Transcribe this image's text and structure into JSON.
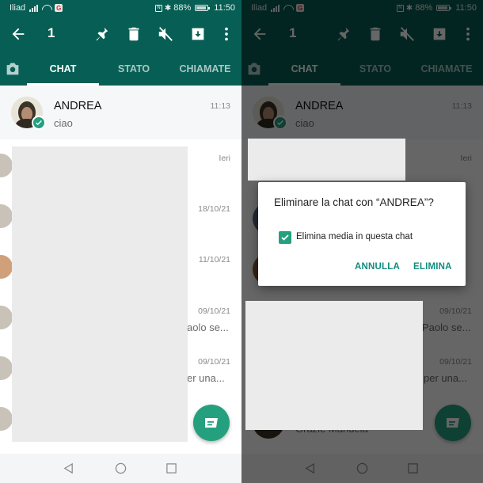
{
  "status_bar": {
    "carrier": "Iliad",
    "battery": "88%",
    "clock": "11:50",
    "icons": [
      "signal-icon",
      "wifi-icon",
      "app-notification-icon",
      "nfc-icon",
      "bluetooth-icon",
      "battery-icon"
    ]
  },
  "action_bar": {
    "selected_count": "1",
    "actions": [
      "back-arrow-icon",
      "pin-icon",
      "delete-icon",
      "mute-icon",
      "archive-icon",
      "more-options-icon"
    ]
  },
  "tabs": {
    "camera_icon": "camera-icon",
    "items": [
      {
        "label": "CHAT",
        "active": true
      },
      {
        "label": "STATO",
        "active": false
      },
      {
        "label": "CHIAMATE",
        "active": false
      }
    ]
  },
  "chats": [
    {
      "name": "ANDREA",
      "preview": "ciao",
      "time": "11:13",
      "selected": true
    },
    {
      "time": "Ieri"
    },
    {
      "time": "18/10/21"
    },
    {
      "time": "11/10/21"
    },
    {
      "time": "09/10/21",
      "preview_tail_left": "aolo se...",
      "preview_tail_right": "Paolo se..."
    },
    {
      "time": "09/10/21",
      "preview_tail_left": "er una...",
      "preview_tail_right": "per una..."
    },
    {
      "preview_tail_right": "Grazie Manuela"
    }
  ],
  "fab": {
    "icon": "new-chat-icon"
  },
  "nav_bar": {
    "icons": [
      "nav-back-icon",
      "nav-home-icon",
      "nav-recents-icon"
    ]
  },
  "dialog": {
    "title": "Eliminare la chat con “ANDREA”?",
    "checkbox_label": "Elimina media in questa chat",
    "checkbox_checked": true,
    "cancel_label": "ANNULLA",
    "confirm_label": "ELIMINA"
  },
  "colors": {
    "header": "#075e54",
    "accent": "#25a07f",
    "dialog_button": "#128c7e",
    "redaction": "#ebebeb"
  }
}
